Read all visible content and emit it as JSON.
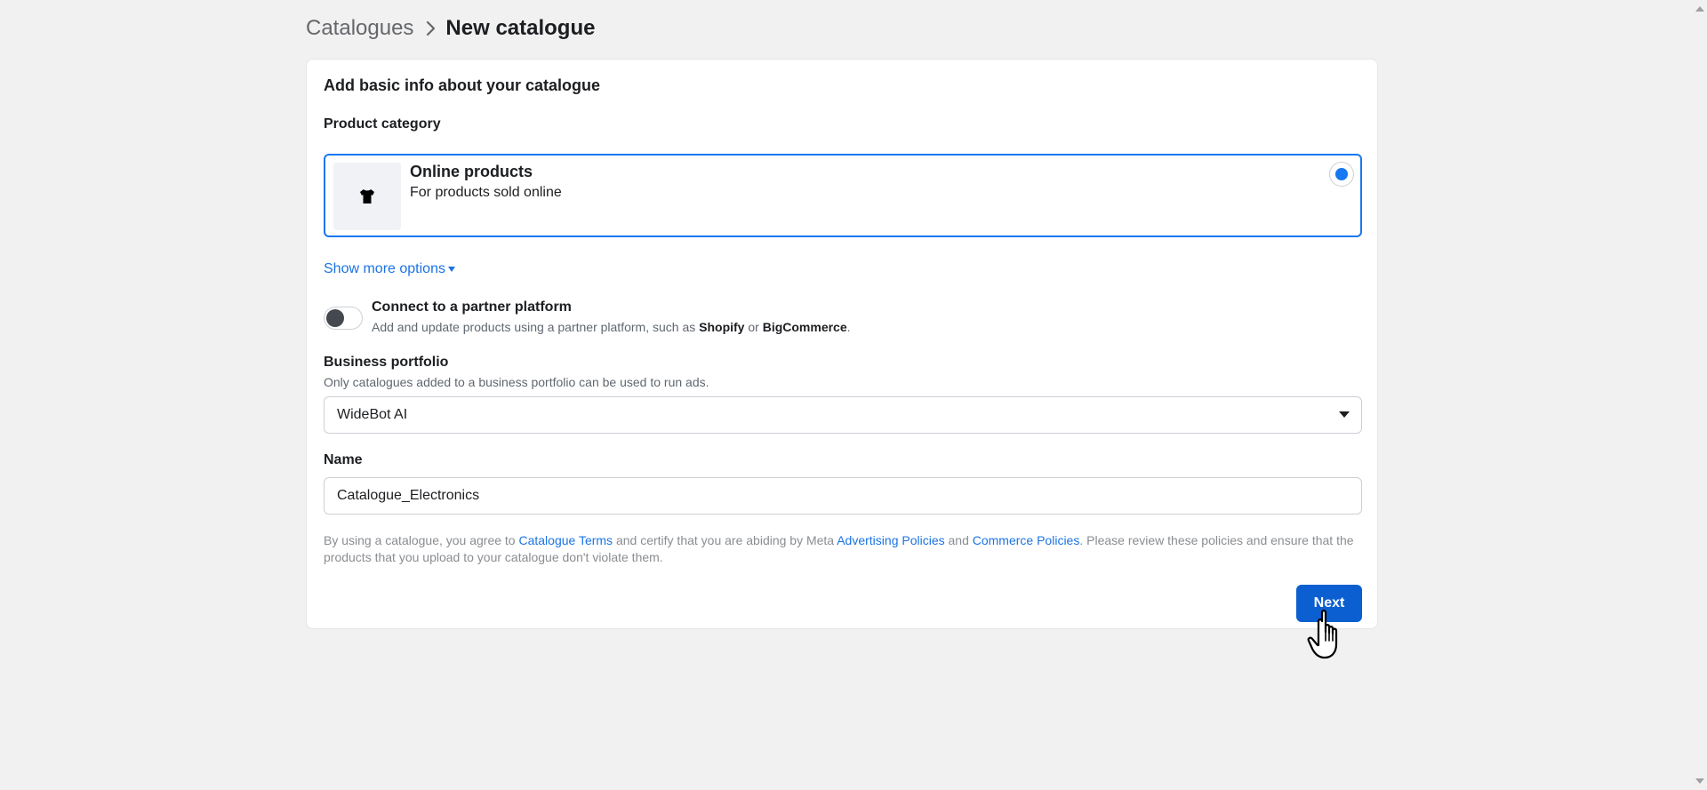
{
  "breadcrumb": {
    "parent": "Catalogues",
    "current": "New catalogue",
    "separator_icon": "chevron-right-icon"
  },
  "card": {
    "title": "Add basic info about your catalogue",
    "product_category": {
      "label": "Product category",
      "option": {
        "title": "Online products",
        "subtitle": "For products sold online",
        "icon": "tshirt-icon",
        "selected": true
      },
      "show_more": "Show more options"
    },
    "partner": {
      "title": "Connect to a partner platform",
      "desc_prefix": "Add and update products using a partner platform, such as ",
      "platform1": "Shopify",
      "desc_or": " or ",
      "platform2": "BigCommerce",
      "desc_suffix": ".",
      "enabled": false
    },
    "business_portfolio": {
      "label": "Business portfolio",
      "helper": "Only catalogues added to a business portfolio can be used to run ads.",
      "selected": "WideBot AI"
    },
    "name": {
      "label": "Name",
      "value": "Catalogue_Electronics"
    },
    "terms": {
      "t1": "By using a catalogue, you agree to ",
      "link1": "Catalogue Terms",
      "t2": " and certify that you are abiding by Meta ",
      "link2": "Advertising Policies",
      "t3": " and ",
      "link3": "Commerce Policies",
      "t4": ". Please review these policies and ensure that the products that you upload to your catalogue don't violate them."
    },
    "next_label": "Next"
  },
  "colors": {
    "accent": "#1877f2",
    "link": "#1b74e4",
    "button": "#0b5fd1",
    "background": "#f1f1f1"
  }
}
